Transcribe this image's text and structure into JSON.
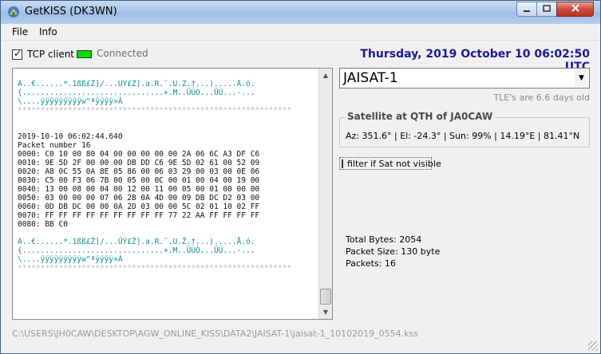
{
  "window": {
    "title": "GetKISS (DK3WN)"
  },
  "menu": {
    "items": [
      "File",
      "Info"
    ]
  },
  "connection": {
    "tcp_label": "TCP client",
    "tcp_checked": true,
    "status": "Connected",
    "led_color": "#00e000"
  },
  "datetime": "Thursday, 2019 October 10   06:02:50 UTC",
  "log": {
    "lines": [
      {
        "kind": "ascii",
        "text": "À..€......*.1ßß£Ž]/...ÛÝ£Ž].a.R.¨.U.Ž.†...).....Å.ó."
      },
      {
        "kind": "ascii",
        "text": "{...............................+.M..ÜÙÒ...ÜÙ...-..."
      },
      {
        "kind": "ascii",
        "text": "\\....ÿÿÿÿÿÿÿÿÿw\"ªÿÿÿÿ»À"
      },
      {
        "kind": "sep",
        "text": "************************************************************"
      },
      {
        "kind": "blank",
        "text": " "
      },
      {
        "kind": "blank",
        "text": " "
      },
      {
        "kind": "hex",
        "text": "2019-10-10 06:02:44.640"
      },
      {
        "kind": "hex",
        "text": "Packet number 16"
      },
      {
        "kind": "hex",
        "text": "0000: C0 10 00 80 04 00 00 00 00 00 2A 06 6C A3 DF C6"
      },
      {
        "kind": "hex",
        "text": "0010: 9E 5D 2F 00 00 00 DB DD C6 9E 5D 02 61 00 52 09"
      },
      {
        "kind": "hex",
        "text": "0020: A8 0C 55 0A 8E 05 86 00 06 03 29 00 03 00 0E 06"
      },
      {
        "kind": "hex",
        "text": "0030: C5 00 F3 06 7B 00 05 00 0C 00 01 00 04 00 19 00"
      },
      {
        "kind": "hex",
        "text": "0040: 13 00 08 00 04 00 12 00 11 00 05 00 01 00 00 00"
      },
      {
        "kind": "hex",
        "text": "0050: 03 00 00 00 07 06 2B 0A 4D 00 09 DB DC D2 03 00"
      },
      {
        "kind": "hex",
        "text": "0060: 0D DB DC 00 00 0A 2D 03 00 00 5C 02 01 10 02 FF"
      },
      {
        "kind": "hex",
        "text": "0070: FF FF FF FF FF FF FF FF FF 77 22 AA FF FF FF FF"
      },
      {
        "kind": "hex",
        "text": "0080: BB C0"
      },
      {
        "kind": "blank",
        "text": " "
      },
      {
        "kind": "ascii",
        "text": "À..€......*.1ßß£Ž]/...ÛÝ£Ž].a.R.¨.U.Ž.†...).....Å.ó."
      },
      {
        "kind": "ascii",
        "text": "{...............................+.M..ÜÙÒ...ÜÙ...-..."
      },
      {
        "kind": "ascii",
        "text": "\\....ÿÿÿÿÿÿÿÿÿw\"ªÿÿÿÿ»À"
      },
      {
        "kind": "sep",
        "text": "************************************************************"
      }
    ]
  },
  "satellite": {
    "selected": "JAISAT-1",
    "tle_age": "TLE's are 6.6 days old",
    "qth_title": "Satellite at QTH of JA0CAW",
    "position": "Az: 351.6° | El: -24.3° | Sun: 99% | 14.19°E | 81.41°N"
  },
  "filter": {
    "label": "filter if Sat not visible",
    "checked": false
  },
  "stats": {
    "total_bytes": "Total Bytes: 2054",
    "packet_size": "Packet Size: 130 byte",
    "packets": "Packets: 16"
  },
  "file_path": "C:\\USERS\\JH0CAW\\DESKTOP\\AGW_ONLINE_KISS\\DATA2\\JAISAT-1\\jaisat-1_10102019_0554.kss"
}
